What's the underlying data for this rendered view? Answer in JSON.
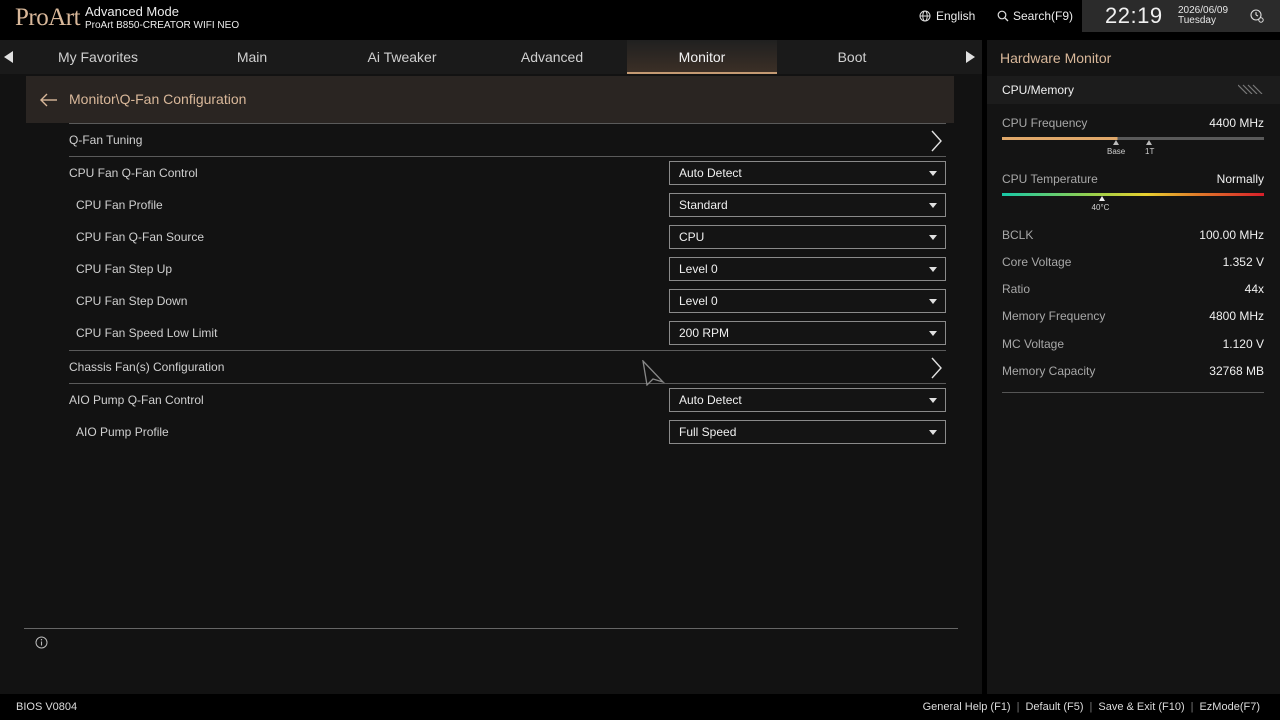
{
  "header": {
    "logo": "ProArt",
    "mode": "Advanced Mode",
    "board": "ProArt B850-CREATOR WIFI NEO",
    "language": "English",
    "search": "Search(F9)",
    "time": "22:19",
    "date": "2026/06/09",
    "weekday": "Tuesday"
  },
  "tabs": [
    {
      "label": "My Favorites"
    },
    {
      "label": "Main"
    },
    {
      "label": "Ai Tweaker"
    },
    {
      "label": "Advanced"
    },
    {
      "label": "Monitor"
    },
    {
      "label": "Boot"
    }
  ],
  "active_tab": "Monitor",
  "breadcrumb": "Monitor\\Q-Fan Configuration",
  "settings": {
    "qfan_tuning": "Q-Fan Tuning",
    "cpu_qfan_control": {
      "label": "CPU Fan Q-Fan Control",
      "value": "Auto Detect"
    },
    "cpu_fan_profile": {
      "label": "CPU Fan Profile",
      "value": "Standard"
    },
    "cpu_qfan_source": {
      "label": "CPU Fan Q-Fan Source",
      "value": "CPU"
    },
    "cpu_step_up": {
      "label": "CPU Fan Step Up",
      "value": "Level 0"
    },
    "cpu_step_down": {
      "label": "CPU Fan Step Down",
      "value": "Level 0"
    },
    "cpu_speed_low_limit": {
      "label": "CPU Fan Speed Low Limit",
      "value": "200 RPM"
    },
    "chassis_config": "Chassis Fan(s) Configuration",
    "aio_qfan_control": {
      "label": "AIO Pump Q-Fan Control",
      "value": "Auto Detect"
    },
    "aio_profile": {
      "label": "AIO Pump Profile",
      "value": "Full Speed"
    }
  },
  "hardware_monitor": {
    "title": "Hardware Monitor",
    "section": "CPU/Memory",
    "cpu_frequency": {
      "label": "CPU Frequency",
      "value": "4400 MHz",
      "base": "Base",
      "turbo": "1T",
      "level": 0.44
    },
    "cpu_temperature": {
      "label": "CPU Temperature",
      "value": "Normally",
      "marker": "40°C",
      "level": 0.38
    },
    "bclk": {
      "label": "BCLK",
      "value": "100.00 MHz"
    },
    "core_voltage": {
      "label": "Core Voltage",
      "value": "1.352 V"
    },
    "ratio": {
      "label": "Ratio",
      "value": "44x"
    },
    "memory_frequency": {
      "label": "Memory Frequency",
      "value": "4800 MHz"
    },
    "mc_voltage": {
      "label": "MC Voltage",
      "value": "1.120 V"
    },
    "memory_capacity": {
      "label": "Memory Capacity",
      "value": "32768 MB"
    }
  },
  "footer": {
    "bios_version": "BIOS V0804",
    "help": "General Help (F1)",
    "default": "Default (F5)",
    "save_exit": "Save & Exit (F10)",
    "ezmode": "EzMode(F7)"
  },
  "colors": {
    "accent": "#d9b89a",
    "tab_underline": "#c49a73"
  }
}
